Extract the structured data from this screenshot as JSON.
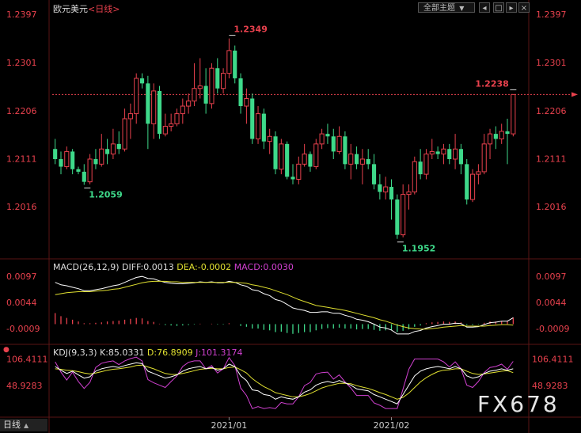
{
  "title": {
    "pair": "欧元美元",
    "period": "<日线>"
  },
  "toolbar": {
    "theme_label": "全部主题",
    "theme_arrow": "▼",
    "buttons": [
      "chevron-left-icon",
      "square-icon",
      "chevron-right-icon",
      "close-icon"
    ]
  },
  "price_axis_ticks": [
    "1.2397",
    "1.2301",
    "1.2206",
    "1.2111",
    "1.2016"
  ],
  "current_price_line": 1.2238,
  "date_labels": [
    "2021/01",
    "2021/02"
  ],
  "period_selector": {
    "label": "日线",
    "arrow": "▲"
  },
  "watermark": "FX678",
  "macd": {
    "label": "MACD(26,12,9)",
    "diff": "DIFF:0.0013",
    "dea": "DEA:-0.0002",
    "macd": "MACD:0.0030",
    "ticks": [
      "0.0097",
      "0.0044",
      "-0.0009"
    ],
    "colors": {
      "diff": "#ffffff",
      "dea": "#e0e030",
      "macd": "#d040d0"
    }
  },
  "kdj": {
    "label": "KDJ(9,3,3)",
    "k": "K:85.0331",
    "d": "D:76.8909",
    "j": "J:101.3174",
    "ticks": [
      "106.4111",
      "48.9283"
    ],
    "colors": {
      "k": "#ffffff",
      "d": "#e0e030",
      "j": "#d040d0"
    }
  },
  "colors": {
    "up": "#e8414d",
    "down": "#3ed98a",
    "bg": "#000000",
    "axis": "#e8414d"
  },
  "chart_data": {
    "type": "candlestick",
    "title": "欧元美元<日线>",
    "ylim": [
      1.195,
      1.2397
    ],
    "high_annotation": {
      "label": "1.2349",
      "value": 1.2349
    },
    "low_annotation": {
      "label": "1.1952",
      "value": 1.1952
    },
    "local_low_annotation": {
      "label": "1.2059",
      "value": 1.2059
    },
    "last_annotation": {
      "label": "1.2238",
      "value": 1.2238
    },
    "candles": [
      {
        "o": 1.213,
        "h": 1.215,
        "l": 1.21,
        "c": 1.211
      },
      {
        "o": 1.211,
        "h": 1.2125,
        "l": 1.208,
        "c": 1.2095
      },
      {
        "o": 1.2095,
        "h": 1.2135,
        "l": 1.209,
        "c": 1.2125
      },
      {
        "o": 1.2125,
        "h": 1.213,
        "l": 1.208,
        "c": 1.209
      },
      {
        "o": 1.209,
        "h": 1.2095,
        "l": 1.208,
        "c": 1.2085
      },
      {
        "o": 1.2085,
        "h": 1.21,
        "l": 1.2059,
        "c": 1.2065
      },
      {
        "o": 1.2065,
        "h": 1.212,
        "l": 1.206,
        "c": 1.211
      },
      {
        "o": 1.211,
        "h": 1.213,
        "l": 1.209,
        "c": 1.21
      },
      {
        "o": 1.21,
        "h": 1.216,
        "l": 1.2095,
        "c": 1.213
      },
      {
        "o": 1.213,
        "h": 1.215,
        "l": 1.21,
        "c": 1.212
      },
      {
        "o": 1.212,
        "h": 1.217,
        "l": 1.211,
        "c": 1.214
      },
      {
        "o": 1.214,
        "h": 1.2165,
        "l": 1.212,
        "c": 1.213
      },
      {
        "o": 1.213,
        "h": 1.221,
        "l": 1.2125,
        "c": 1.219
      },
      {
        "o": 1.219,
        "h": 1.222,
        "l": 1.215,
        "c": 1.22
      },
      {
        "o": 1.22,
        "h": 1.228,
        "l": 1.218,
        "c": 1.227
      },
      {
        "o": 1.227,
        "h": 1.228,
        "l": 1.225,
        "c": 1.226
      },
      {
        "o": 1.226,
        "h": 1.2275,
        "l": 1.213,
        "c": 1.218
      },
      {
        "o": 1.218,
        "h": 1.226,
        "l": 1.215,
        "c": 1.2245
      },
      {
        "o": 1.2245,
        "h": 1.2255,
        "l": 1.215,
        "c": 1.216
      },
      {
        "o": 1.216,
        "h": 1.22,
        "l": 1.2155,
        "c": 1.2175
      },
      {
        "o": 1.2175,
        "h": 1.22,
        "l": 1.2165,
        "c": 1.218
      },
      {
        "o": 1.218,
        "h": 1.221,
        "l": 1.2175,
        "c": 1.22
      },
      {
        "o": 1.22,
        "h": 1.223,
        "l": 1.218,
        "c": 1.2215
      },
      {
        "o": 1.2215,
        "h": 1.224,
        "l": 1.22,
        "c": 1.2225
      },
      {
        "o": 1.2225,
        "h": 1.23,
        "l": 1.2215,
        "c": 1.225
      },
      {
        "o": 1.225,
        "h": 1.231,
        "l": 1.223,
        "c": 1.2255
      },
      {
        "o": 1.2255,
        "h": 1.229,
        "l": 1.22,
        "c": 1.222
      },
      {
        "o": 1.222,
        "h": 1.23,
        "l": 1.221,
        "c": 1.229
      },
      {
        "o": 1.229,
        "h": 1.231,
        "l": 1.224,
        "c": 1.225
      },
      {
        "o": 1.225,
        "h": 1.229,
        "l": 1.224,
        "c": 1.228
      },
      {
        "o": 1.228,
        "h": 1.2349,
        "l": 1.227,
        "c": 1.2325
      },
      {
        "o": 1.2325,
        "h": 1.2335,
        "l": 1.226,
        "c": 1.227
      },
      {
        "o": 1.227,
        "h": 1.228,
        "l": 1.22,
        "c": 1.2215
      },
      {
        "o": 1.2215,
        "h": 1.225,
        "l": 1.218,
        "c": 1.223
      },
      {
        "o": 1.223,
        "h": 1.224,
        "l": 1.214,
        "c": 1.215
      },
      {
        "o": 1.215,
        "h": 1.2215,
        "l": 1.214,
        "c": 1.22
      },
      {
        "o": 1.22,
        "h": 1.221,
        "l": 1.213,
        "c": 1.2145
      },
      {
        "o": 1.2145,
        "h": 1.217,
        "l": 1.212,
        "c": 1.2155
      },
      {
        "o": 1.2155,
        "h": 1.2165,
        "l": 1.208,
        "c": 1.209
      },
      {
        "o": 1.209,
        "h": 1.215,
        "l": 1.208,
        "c": 1.214
      },
      {
        "o": 1.214,
        "h": 1.2145,
        "l": 1.207,
        "c": 1.2075
      },
      {
        "o": 1.2075,
        "h": 1.21,
        "l": 1.206,
        "c": 1.207
      },
      {
        "o": 1.207,
        "h": 1.2115,
        "l": 1.206,
        "c": 1.21
      },
      {
        "o": 1.21,
        "h": 1.214,
        "l": 1.2095,
        "c": 1.212
      },
      {
        "o": 1.212,
        "h": 1.2125,
        "l": 1.2085,
        "c": 1.2095
      },
      {
        "o": 1.2095,
        "h": 1.215,
        "l": 1.209,
        "c": 1.214
      },
      {
        "o": 1.214,
        "h": 1.217,
        "l": 1.213,
        "c": 1.216
      },
      {
        "o": 1.216,
        "h": 1.218,
        "l": 1.214,
        "c": 1.2155
      },
      {
        "o": 1.2155,
        "h": 1.217,
        "l": 1.211,
        "c": 1.2125
      },
      {
        "o": 1.2125,
        "h": 1.2175,
        "l": 1.212,
        "c": 1.2155
      },
      {
        "o": 1.2155,
        "h": 1.2165,
        "l": 1.209,
        "c": 1.21
      },
      {
        "o": 1.21,
        "h": 1.214,
        "l": 1.207,
        "c": 1.212
      },
      {
        "o": 1.212,
        "h": 1.2135,
        "l": 1.209,
        "c": 1.21
      },
      {
        "o": 1.21,
        "h": 1.213,
        "l": 1.206,
        "c": 1.211
      },
      {
        "o": 1.211,
        "h": 1.213,
        "l": 1.209,
        "c": 1.21
      },
      {
        "o": 1.21,
        "h": 1.212,
        "l": 1.205,
        "c": 1.206
      },
      {
        "o": 1.206,
        "h": 1.208,
        "l": 1.203,
        "c": 1.2045
      },
      {
        "o": 1.2045,
        "h": 1.2075,
        "l": 1.203,
        "c": 1.2055
      },
      {
        "o": 1.2055,
        "h": 1.207,
        "l": 1.199,
        "c": 1.203
      },
      {
        "o": 1.203,
        "h": 1.204,
        "l": 1.1952,
        "c": 1.196
      },
      {
        "o": 1.196,
        "h": 1.206,
        "l": 1.1955,
        "c": 1.204
      },
      {
        "o": 1.204,
        "h": 1.206,
        "l": 1.201,
        "c": 1.2045
      },
      {
        "o": 1.2045,
        "h": 1.2115,
        "l": 1.204,
        "c": 1.2105
      },
      {
        "o": 1.2105,
        "h": 1.213,
        "l": 1.207,
        "c": 1.208
      },
      {
        "o": 1.208,
        "h": 1.213,
        "l": 1.207,
        "c": 1.212
      },
      {
        "o": 1.212,
        "h": 1.215,
        "l": 1.211,
        "c": 1.2125
      },
      {
        "o": 1.2125,
        "h": 1.2135,
        "l": 1.211,
        "c": 1.212
      },
      {
        "o": 1.212,
        "h": 1.214,
        "l": 1.21,
        "c": 1.213
      },
      {
        "o": 1.213,
        "h": 1.214,
        "l": 1.21,
        "c": 1.211
      },
      {
        "o": 1.211,
        "h": 1.216,
        "l": 1.209,
        "c": 1.213
      },
      {
        "o": 1.213,
        "h": 1.214,
        "l": 1.208,
        "c": 1.21
      },
      {
        "o": 1.21,
        "h": 1.211,
        "l": 1.202,
        "c": 1.203
      },
      {
        "o": 1.203,
        "h": 1.209,
        "l": 1.2025,
        "c": 1.208
      },
      {
        "o": 1.208,
        "h": 1.21,
        "l": 1.206,
        "c": 1.2085
      },
      {
        "o": 1.2085,
        "h": 1.216,
        "l": 1.208,
        "c": 1.214
      },
      {
        "o": 1.214,
        "h": 1.217,
        "l": 1.211,
        "c": 1.216
      },
      {
        "o": 1.216,
        "h": 1.2175,
        "l": 1.213,
        "c": 1.215
      },
      {
        "o": 1.215,
        "h": 1.218,
        "l": 1.214,
        "c": 1.2165
      },
      {
        "o": 1.2165,
        "h": 1.219,
        "l": 1.21,
        "c": 1.216
      },
      {
        "o": 1.216,
        "h": 1.2238,
        "l": 1.2155,
        "c": 1.2238
      }
    ],
    "macd_diff": [
      0.0085,
      0.008,
      0.0078,
      0.0075,
      0.0072,
      0.0068,
      0.0068,
      0.007,
      0.0072,
      0.0075,
      0.0078,
      0.008,
      0.0085,
      0.009,
      0.0095,
      0.0097,
      0.0093,
      0.0092,
      0.0088,
      0.0085,
      0.0083,
      0.0082,
      0.0082,
      0.0083,
      0.0084,
      0.0086,
      0.0085,
      0.0086,
      0.0084,
      0.0084,
      0.0087,
      0.0085,
      0.008,
      0.0077,
      0.007,
      0.0068,
      0.0062,
      0.0058,
      0.005,
      0.0047,
      0.004,
      0.0033,
      0.003,
      0.0028,
      0.0024,
      0.0024,
      0.0025,
      0.0025,
      0.0022,
      0.0022,
      0.0018,
      0.0015,
      0.001,
      0.0008,
      0.0005,
      0.0,
      -0.0006,
      -0.0008,
      -0.0012,
      -0.002,
      -0.002,
      -0.002,
      -0.0015,
      -0.0013,
      -0.0008,
      -0.0005,
      -0.0003,
      0.0,
      0.0,
      0.0002,
      0.0001,
      -0.0006,
      -0.0006,
      -0.0005,
      -0.0001,
      0.0003,
      0.0004,
      0.0006,
      0.0006,
      0.0013
    ],
    "macd_dea": [
      0.006,
      0.0062,
      0.0064,
      0.0065,
      0.0066,
      0.0066,
      0.0066,
      0.0067,
      0.0068,
      0.0069,
      0.0071,
      0.0072,
      0.0075,
      0.0078,
      0.0081,
      0.0084,
      0.0086,
      0.0087,
      0.0087,
      0.0087,
      0.0086,
      0.0086,
      0.0085,
      0.0085,
      0.0085,
      0.0085,
      0.0085,
      0.0085,
      0.0085,
      0.0085,
      0.0085,
      0.0085,
      0.0084,
      0.0083,
      0.008,
      0.0078,
      0.0075,
      0.0072,
      0.0068,
      0.0064,
      0.006,
      0.0055,
      0.005,
      0.0046,
      0.0042,
      0.0038,
      0.0036,
      0.0034,
      0.0032,
      0.003,
      0.0028,
      0.0025,
      0.0022,
      0.0019,
      0.0016,
      0.0013,
      0.0009,
      0.0006,
      0.0002,
      -0.0002,
      -0.0005,
      -0.0008,
      -0.0009,
      -0.001,
      -0.001,
      -0.0009,
      -0.0008,
      -0.0006,
      -0.0005,
      -0.0004,
      -0.0003,
      -0.0004,
      -0.0004,
      -0.0004,
      -0.0004,
      -0.0003,
      -0.0002,
      -0.0001,
      -0.0001,
      -0.0002
    ],
    "macd_hist": [
      0.005,
      0.0036,
      0.0028,
      0.002,
      0.0012,
      0.0004,
      0.0004,
      0.0006,
      0.0008,
      0.0012,
      0.0014,
      0.0016,
      0.002,
      0.0024,
      0.0028,
      0.0026,
      0.0014,
      0.001,
      0.0002,
      -0.0004,
      -0.0006,
      -0.0008,
      -0.0006,
      -0.0004,
      -0.0002,
      0.0002,
      0.0,
      0.0002,
      -0.0002,
      -0.0002,
      0.0004,
      0.0,
      -0.0008,
      -0.0012,
      -0.002,
      -0.002,
      -0.0026,
      -0.0028,
      -0.0036,
      -0.0034,
      -0.004,
      -0.0044,
      -0.004,
      -0.0036,
      -0.0036,
      -0.0028,
      -0.0022,
      -0.0018,
      -0.002,
      -0.0016,
      -0.002,
      -0.002,
      -0.0024,
      -0.0022,
      -0.0022,
      -0.0026,
      -0.003,
      -0.0028,
      -0.0028,
      -0.0036,
      -0.003,
      -0.0024,
      -0.0012,
      -0.0006,
      0.0004,
      0.0008,
      0.001,
      0.0012,
      0.001,
      0.0012,
      0.0008,
      -0.0004,
      -0.0004,
      -0.0002,
      0.0006,
      0.0012,
      0.0012,
      0.0014,
      0.0014,
      0.003
    ],
    "kdj_k": [
      90,
      82,
      75,
      80,
      72,
      65,
      68,
      80,
      85,
      88,
      90,
      88,
      92,
      95,
      98,
      96,
      80,
      75,
      70,
      65,
      68,
      72,
      80,
      85,
      88,
      90,
      85,
      88,
      82,
      85,
      95,
      90,
      70,
      60,
      40,
      38,
      30,
      28,
      20,
      25,
      22,
      20,
      25,
      35,
      40,
      50,
      55,
      58,
      55,
      60,
      55,
      50,
      42,
      40,
      38,
      30,
      25,
      20,
      15,
      10,
      30,
      50,
      70,
      80,
      85,
      88,
      90,
      88,
      85,
      90,
      85,
      70,
      65,
      68,
      75,
      80,
      82,
      85,
      82,
      85
    ],
    "kdj_d": [
      85,
      84,
      82,
      81,
      79,
      76,
      74,
      76,
      79,
      82,
      84,
      85,
      87,
      89,
      92,
      93,
      89,
      85,
      80,
      75,
      73,
      73,
      75,
      78,
      81,
      84,
      85,
      86,
      85,
      85,
      88,
      89,
      83,
      76,
      64,
      55,
      47,
      41,
      34,
      31,
      28,
      25,
      25,
      28,
      32,
      38,
      44,
      48,
      51,
      54,
      54,
      53,
      49,
      46,
      43,
      39,
      34,
      30,
      25,
      20,
      24,
      33,
      45,
      57,
      66,
      73,
      79,
      82,
      83,
      85,
      85,
      80,
      75,
      73,
      74,
      76,
      78,
      80,
      81,
      77
    ],
    "kdj_j": [
      100,
      78,
      61,
      78,
      58,
      43,
      56,
      88,
      97,
      100,
      102,
      94,
      102,
      107,
      110,
      102,
      62,
      55,
      50,
      45,
      58,
      70,
      90,
      99,
      102,
      102,
      85,
      92,
      76,
      85,
      109,
      92,
      44,
      28,
      0,
      4,
      0,
      2,
      0,
      13,
      10,
      10,
      25,
      49,
      56,
      74,
      77,
      78,
      63,
      72,
      57,
      44,
      28,
      28,
      28,
      12,
      7,
      0,
      0,
      0,
      42,
      84,
      106,
      106,
      106,
      106,
      106,
      100,
      89,
      100,
      85,
      50,
      45,
      58,
      77,
      88,
      90,
      95,
      84,
      101
    ]
  }
}
